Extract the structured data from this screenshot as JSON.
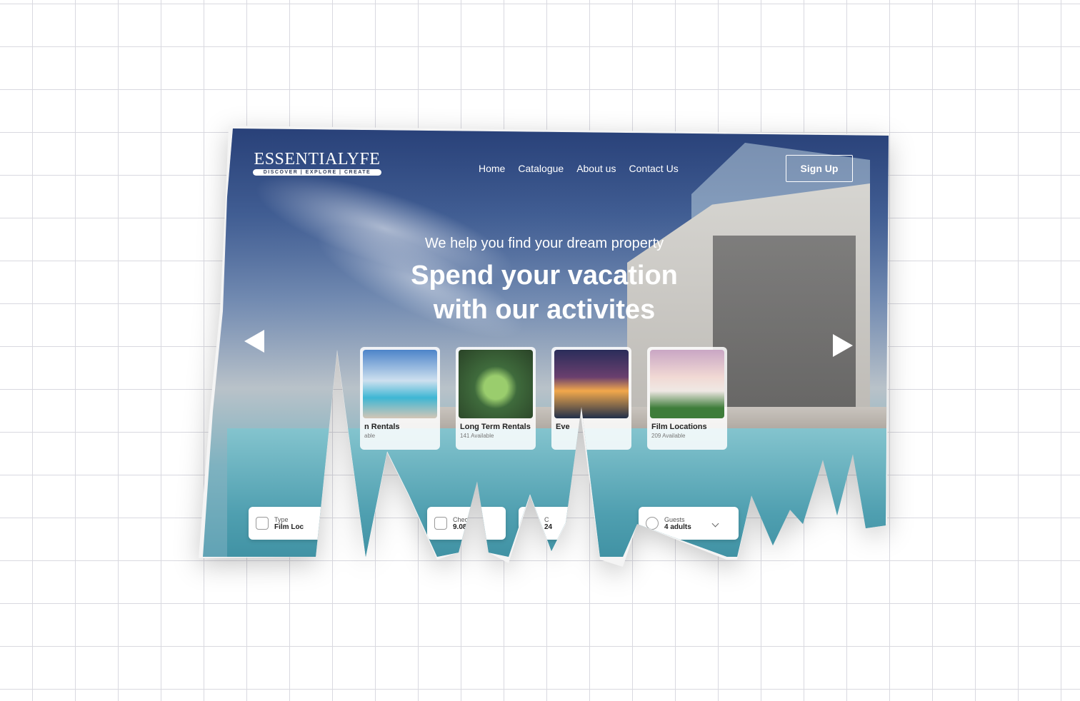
{
  "brand": {
    "name": "ESSENTIALYFE",
    "tagline": "DISCOVER | EXPLORE | CREATE"
  },
  "nav": [
    {
      "label": "Home"
    },
    {
      "label": "Catalogue"
    },
    {
      "label": "About us"
    },
    {
      "label": "Contact Us"
    }
  ],
  "signup_label": "Sign Up",
  "hero": {
    "subtitle": "We help you find your dream property",
    "title_line1": "Spend your vacation",
    "title_line2": "with our activites"
  },
  "cards": [
    {
      "title": "n Rentals",
      "available": "able"
    },
    {
      "title": "Long Term Rentals",
      "available": "141 Available"
    },
    {
      "title": "Eve",
      "available": ""
    },
    {
      "title": "Film Locations",
      "available": "209 Available"
    }
  ],
  "search": {
    "type": {
      "label": "Type",
      "value": "Film Loc"
    },
    "checkin": {
      "label": "Chec",
      "value": "9.08."
    },
    "checkout": {
      "label": "C",
      "value": "24"
    },
    "guests": {
      "label": "Guests",
      "value": "4 adults"
    }
  },
  "icons": {
    "prev": "triangle-left-icon",
    "next": "triangle-right-icon",
    "type": "building-icon",
    "checkin": "calendar-icon",
    "checkout": "clock-icon",
    "guests": "person-icon",
    "dropdown": "chevron-down-icon"
  }
}
